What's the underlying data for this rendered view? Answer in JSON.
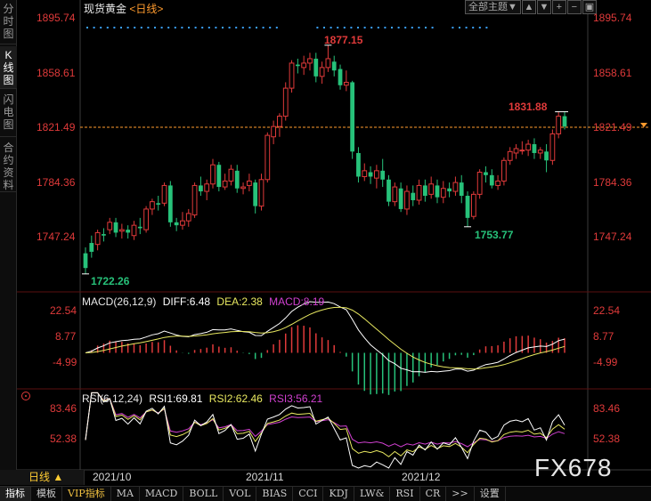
{
  "sidebar": {
    "tabs": [
      {
        "label": "分时图",
        "active": false
      },
      {
        "label": "K线图",
        "active": true
      },
      {
        "label": "闪电图",
        "active": false
      },
      {
        "label": "合约资料",
        "active": false
      }
    ]
  },
  "header": {
    "title": "现货黄金",
    "period": "<日线>",
    "theme_label": "全部主题▼"
  },
  "price_axis": {
    "ticks": [
      "1895.74",
      "1858.61",
      "1821.49",
      "1784.36",
      "1747.24"
    ],
    "current_line": "1821.49"
  },
  "price_annotations": {
    "high": "1877.15",
    "low_start": "1722.26",
    "low_local": "1753.77",
    "recent_high": "1831.88"
  },
  "macd": {
    "title": "MACD(26,12,9)",
    "diff": "DIFF:6.48",
    "dea": "DEA:2.38",
    "macd": "MACD:8.19",
    "ticks": [
      "22.54",
      "8.77",
      "-4.99"
    ]
  },
  "rsi": {
    "title": "RSI(6,12,24)",
    "rsi1": "RSI1:69.81",
    "rsi2": "RSI2:62.46",
    "rsi3": "RSI3:56.21",
    "ticks": [
      "83.46",
      "52.38"
    ]
  },
  "bottom": {
    "period": "日线 ▲",
    "dates": [
      "2021/10",
      "2021/11",
      "2021/12"
    ],
    "tabs": [
      {
        "label": "指标",
        "style": "active"
      },
      {
        "label": "模板",
        "style": ""
      },
      {
        "label": "VIP指标",
        "style": "vip"
      },
      {
        "label": "MA",
        "style": ""
      },
      {
        "label": "MACD",
        "style": ""
      },
      {
        "label": "BOLL",
        "style": ""
      },
      {
        "label": "VOL",
        "style": ""
      },
      {
        "label": "BIAS",
        "style": ""
      },
      {
        "label": "CCI",
        "style": ""
      },
      {
        "label": "KDJ",
        "style": ""
      },
      {
        "label": "LW&",
        "style": ""
      },
      {
        "label": "RSI",
        "style": ""
      },
      {
        "label": "CR",
        "style": ""
      },
      {
        "label": ">>",
        "style": ""
      },
      {
        "label": "设置",
        "style": ""
      }
    ]
  },
  "watermark": "FX678",
  "colors": {
    "up": "#e03a3a",
    "down": "#27c27a",
    "diff": "#ffffff",
    "dea": "#e8e860",
    "rsi3": "#d040d0",
    "axis": "#e03a3a"
  },
  "chart_data": {
    "type": "candlestick",
    "dates": [
      "2021/10",
      "2021/11",
      "2021/12"
    ],
    "candles": [
      [
        1736,
        1726,
        1740,
        1722
      ],
      [
        1743,
        1737,
        1748,
        1733
      ],
      [
        1742,
        1750,
        1752,
        1738
      ],
      [
        1749,
        1748,
        1753,
        1744
      ],
      [
        1752,
        1757,
        1760,
        1749
      ],
      [
        1757,
        1750,
        1760,
        1747
      ],
      [
        1751,
        1752,
        1756,
        1746
      ],
      [
        1752,
        1750,
        1755,
        1746
      ],
      [
        1748,
        1755,
        1758,
        1745
      ],
      [
        1754,
        1753,
        1760,
        1749
      ],
      [
        1752,
        1766,
        1768,
        1750
      ],
      [
        1766,
        1771,
        1773,
        1762
      ],
      [
        1770,
        1769,
        1775,
        1765
      ],
      [
        1770,
        1782,
        1784,
        1768
      ],
      [
        1782,
        1757,
        1785,
        1754
      ],
      [
        1757,
        1755,
        1760,
        1751
      ],
      [
        1755,
        1758,
        1764,
        1752
      ],
      [
        1758,
        1763,
        1766,
        1754
      ],
      [
        1762,
        1782,
        1784,
        1760
      ],
      [
        1782,
        1778,
        1788,
        1775
      ],
      [
        1778,
        1783,
        1786,
        1772
      ],
      [
        1783,
        1796,
        1800,
        1780
      ],
      [
        1796,
        1781,
        1798,
        1778
      ],
      [
        1781,
        1785,
        1790,
        1779
      ],
      [
        1785,
        1793,
        1796,
        1782
      ],
      [
        1792,
        1780,
        1796,
        1777
      ],
      [
        1780,
        1781,
        1784,
        1776
      ],
      [
        1782,
        1785,
        1790,
        1778
      ],
      [
        1784,
        1768,
        1786,
        1763
      ],
      [
        1768,
        1786,
        1790,
        1765
      ],
      [
        1786,
        1816,
        1818,
        1784
      ],
      [
        1815,
        1822,
        1826,
        1810
      ],
      [
        1822,
        1829,
        1831,
        1815
      ],
      [
        1829,
        1848,
        1852,
        1826
      ],
      [
        1848,
        1865,
        1867,
        1845
      ],
      [
        1864,
        1863,
        1868,
        1858
      ],
      [
        1862,
        1865,
        1870,
        1857
      ],
      [
        1865,
        1868,
        1872,
        1860
      ],
      [
        1868,
        1856,
        1872,
        1852
      ],
      [
        1856,
        1862,
        1866,
        1851
      ],
      [
        1862,
        1868,
        1877,
        1859
      ],
      [
        1866,
        1860,
        1870,
        1856
      ],
      [
        1861,
        1850,
        1864,
        1847
      ],
      [
        1850,
        1852,
        1860,
        1846
      ],
      [
        1852,
        1805,
        1853,
        1800
      ],
      [
        1804,
        1788,
        1808,
        1784
      ],
      [
        1788,
        1792,
        1797,
        1785
      ],
      [
        1791,
        1788,
        1795,
        1783
      ],
      [
        1787,
        1792,
        1796,
        1780
      ],
      [
        1792,
        1786,
        1800,
        1781
      ],
      [
        1786,
        1771,
        1789,
        1768
      ],
      [
        1771,
        1781,
        1784,
        1768
      ],
      [
        1780,
        1766,
        1784,
        1764
      ],
      [
        1766,
        1778,
        1782,
        1762
      ],
      [
        1777,
        1772,
        1782,
        1768
      ],
      [
        1772,
        1782,
        1786,
        1769
      ],
      [
        1782,
        1775,
        1786,
        1771
      ],
      [
        1776,
        1783,
        1788,
        1773
      ],
      [
        1782,
        1774,
        1786,
        1770
      ],
      [
        1774,
        1780,
        1785,
        1770
      ],
      [
        1780,
        1778,
        1784,
        1774
      ],
      [
        1778,
        1784,
        1788,
        1775
      ],
      [
        1784,
        1775,
        1789,
        1770
      ],
      [
        1775,
        1760,
        1778,
        1754
      ],
      [
        1761,
        1776,
        1778,
        1759
      ],
      [
        1776,
        1791,
        1793,
        1773
      ],
      [
        1791,
        1789,
        1795,
        1784
      ],
      [
        1789,
        1782,
        1793,
        1780
      ],
      [
        1782,
        1785,
        1789,
        1779
      ],
      [
        1785,
        1799,
        1801,
        1782
      ],
      [
        1799,
        1805,
        1808,
        1796
      ],
      [
        1804,
        1807,
        1810,
        1800
      ],
      [
        1806,
        1806,
        1812,
        1803
      ],
      [
        1806,
        1810,
        1813,
        1802
      ],
      [
        1810,
        1804,
        1814,
        1800
      ],
      [
        1804,
        1806,
        1808,
        1800
      ],
      [
        1805,
        1799,
        1810,
        1791
      ],
      [
        1799,
        1817,
        1820,
        1796
      ],
      [
        1817,
        1829,
        1832,
        1814
      ],
      [
        1829,
        1822,
        1832,
        1820
      ]
    ],
    "macd_diff_last": 6.48,
    "macd_dea_last": 2.38,
    "macd_hist_last": 8.19,
    "rsi1_last": 69.81,
    "rsi2_last": 62.46,
    "rsi3_last": 56.21,
    "price_ylim": [
      1715,
      1900
    ],
    "macd_ylim": [
      -10,
      28
    ],
    "rsi_ylim": [
      20,
      100
    ]
  }
}
